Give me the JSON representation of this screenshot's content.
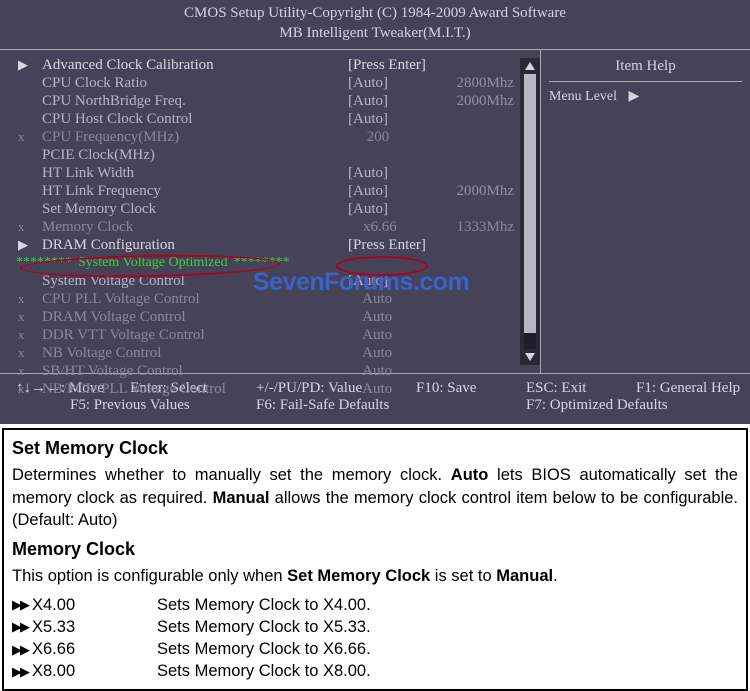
{
  "header": {
    "line1": "CMOS Setup Utility-Copyright (C) 1984-2009 Award Software",
    "line2": "MB Intelligent Tweaker(M.I.T.)"
  },
  "rows": [
    {
      "marker": "▶",
      "label": "Advanced Clock Calibration",
      "val": "[Press Enter]",
      "extra": "",
      "cls": "hdr"
    },
    {
      "marker": "",
      "label": "CPU Clock Ratio",
      "val": "[Auto]",
      "extra": "2800Mhz",
      "cls": ""
    },
    {
      "marker": "",
      "label": "CPU NorthBridge Freq.",
      "val": "[Auto]",
      "extra": "2000Mhz",
      "cls": ""
    },
    {
      "marker": "",
      "label": "CPU Host Clock Control",
      "val": "[Auto]",
      "extra": "",
      "cls": ""
    },
    {
      "marker": "x",
      "label": "CPU Frequency(MHz)",
      "val": "     200",
      "extra": "",
      "cls": "dis"
    },
    {
      "marker": "",
      "label": "PCIE Clock(MHz)",
      "val": "",
      "extra": "",
      "cls": ""
    },
    {
      "marker": "",
      "label": "HT Link Width",
      "val": "[Auto]",
      "extra": "",
      "cls": ""
    },
    {
      "marker": "",
      "label": "HT Link Frequency",
      "val": "[Auto]",
      "extra": "2000Mhz",
      "cls": ""
    },
    {
      "marker": "",
      "label": "Set Memory Clock",
      "val": "[Auto]",
      "extra": "",
      "cls": ""
    },
    {
      "marker": "x",
      "label": "Memory Clock",
      "val": "    x6.66",
      "extra": "1333Mhz",
      "cls": "dis"
    },
    {
      "marker": "▶",
      "label": "DRAM Configuration",
      "val": "[Press Enter]",
      "extra": "",
      "cls": "hdr"
    },
    {
      "divider": true,
      "text": "System Voltage Optimized"
    },
    {
      "marker": "",
      "label": "System Voltage Control",
      "val": "[Auto]",
      "extra": "",
      "cls": ""
    },
    {
      "marker": "x",
      "label": "CPU PLL Voltage Control",
      "val": "    Auto",
      "extra": "",
      "cls": "dis"
    },
    {
      "marker": "x",
      "label": "DRAM Voltage Control",
      "val": "    Auto",
      "extra": "",
      "cls": "dis"
    },
    {
      "marker": "x",
      "label": "DDR VTT Voltage Control",
      "val": "    Auto",
      "extra": "",
      "cls": "dis"
    },
    {
      "marker": "x",
      "label": "NB Voltage Control",
      "val": "    Auto",
      "extra": "",
      "cls": "dis"
    },
    {
      "marker": "x",
      "label": "SB/HT Voltage Control",
      "val": "    Auto",
      "extra": "",
      "cls": "dis"
    },
    {
      "marker": "x",
      "label": "NB/PCIe/PLL Voltage Control",
      "val": "    Auto",
      "extra": "",
      "cls": "dis"
    }
  ],
  "divider_stars": "********",
  "help": {
    "title": "Item Help",
    "level_label": "Menu Level"
  },
  "footer": {
    "move": "↑↓→←: Move",
    "enter": "Enter: Select",
    "pupd": "+/-/PU/PD: Value",
    "f10": "F10: Save",
    "esc": "ESC: Exit",
    "f1": "F1: General Help",
    "f5": "F5: Previous Values",
    "f6": "F6: Fail-Safe Defaults",
    "f7": "F7: Optimized Defaults"
  },
  "watermark": "SevenForums.com",
  "doc": {
    "h1": "Set Memory Clock",
    "p1a": "Determines whether to manually set the memory clock. ",
    "p1b": "Auto",
    "p1c": " lets BIOS automatically set the memory clock as required. ",
    "p1d": "Manual",
    "p1e": " allows the memory clock control item below to be configurable. (Default: Auto)",
    "h2": "Memory Clock",
    "p2a": "This option is configurable only when ",
    "p2b": "Set Memory Clock",
    "p2c": " is set to ",
    "p2d": "Manual",
    "p2e": ".",
    "opts": [
      {
        "label": "X4.00",
        "desc": "Sets Memory Clock to X4.00."
      },
      {
        "label": "X5.33",
        "desc": "Sets Memory Clock to X5.33."
      },
      {
        "label": "X6.66",
        "desc": "Sets Memory Clock to X6.66."
      },
      {
        "label": "X8.00",
        "desc": "Sets Memory Clock to X8.00."
      }
    ]
  }
}
